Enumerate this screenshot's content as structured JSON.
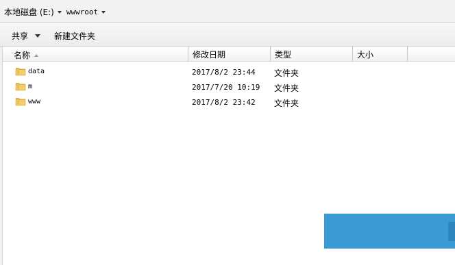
{
  "address": {
    "drive": "本地磁盘 (E:)",
    "folder": "wwwroot"
  },
  "toolbar": {
    "share_label": "共享",
    "new_folder_label": "新建文件夹"
  },
  "columns": {
    "name": "名称",
    "date": "修改日期",
    "type": "类型",
    "size": "大小"
  },
  "files": [
    {
      "name": "data",
      "date": "2017/8/2 23:44",
      "type": "文件夹",
      "icon": "folder-icon"
    },
    {
      "name": "m",
      "date": "2017/7/20 10:19",
      "type": "文件夹",
      "icon": "folder-icon"
    },
    {
      "name": "www",
      "date": "2017/8/2 23:42",
      "type": "文件夹",
      "icon": "folder-icon"
    }
  ],
  "colors": {
    "folder": "#e8c35a",
    "overlay_blue": "#3a9ad4"
  }
}
